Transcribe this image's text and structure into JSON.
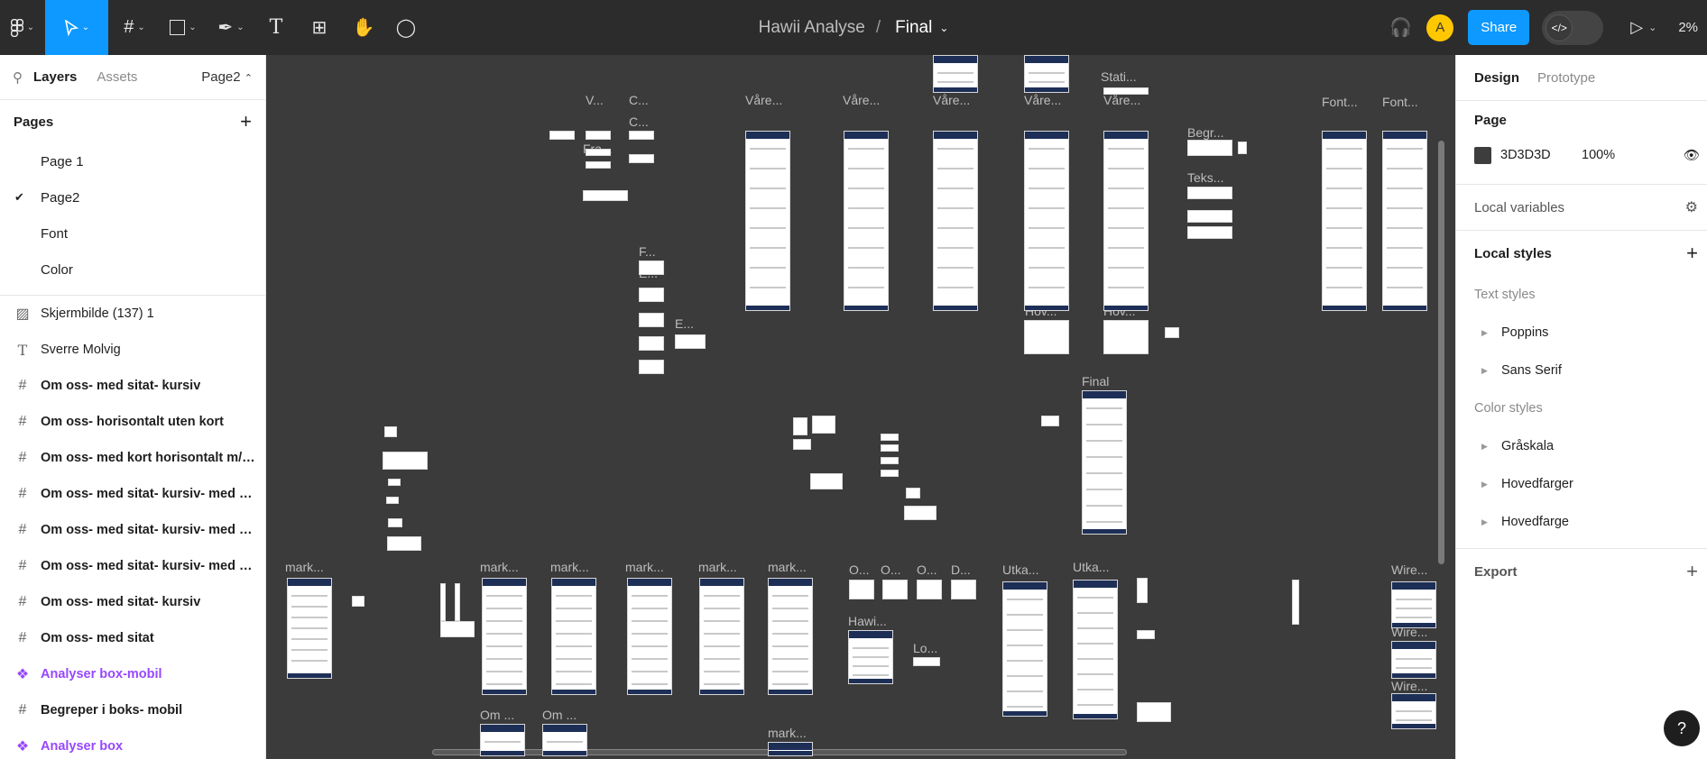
{
  "toolbar": {
    "tools": [
      {
        "name": "main-menu-tool",
        "icon": "figma-logo-icon"
      },
      {
        "name": "move-tool",
        "icon": "cursor-icon",
        "active": true
      },
      {
        "name": "frame-tool",
        "icon": "frame-icon"
      },
      {
        "name": "shape-tool",
        "icon": "rectangle-icon"
      },
      {
        "name": "pen-tool",
        "icon": "pen-icon"
      },
      {
        "name": "text-tool",
        "icon": "text-icon"
      },
      {
        "name": "resources-tool",
        "icon": "components-icon"
      },
      {
        "name": "hand-tool",
        "icon": "hand-icon"
      },
      {
        "name": "comment-tool",
        "icon": "comment-icon"
      }
    ],
    "project": "Hawii Analyse",
    "separator": "/",
    "file": "Final",
    "avatar_initial": "A",
    "share_label": "Share",
    "zoom": "2%"
  },
  "left_panel": {
    "tabs": [
      "Layers",
      "Assets"
    ],
    "active_tab": "Layers",
    "current_page": "Page2",
    "pages_title": "Pages",
    "pages": [
      "Page 1",
      "Page2",
      "Font",
      "Color"
    ],
    "selected_page": "Page2",
    "layers": [
      {
        "type": "image",
        "label": "Skjermbilde (137) 1"
      },
      {
        "type": "text",
        "label": "Sverre Molvig"
      },
      {
        "type": "frame",
        "label": "Om oss- med sitat- kursiv"
      },
      {
        "type": "frame",
        "label": "Om oss- horisontalt uten kort"
      },
      {
        "type": "frame",
        "label": "Om oss- med kort horisontalt m/k..."
      },
      {
        "type": "frame",
        "label": "Om oss- med sitat- kursiv- med bi..."
      },
      {
        "type": "frame",
        "label": "Om oss- med sitat- kursiv- med bi..."
      },
      {
        "type": "frame",
        "label": "Om oss- med sitat- kursiv- med bi..."
      },
      {
        "type": "frame",
        "label": "Om oss- med sitat- kursiv"
      },
      {
        "type": "frame",
        "label": "Om oss- med sitat"
      },
      {
        "type": "component",
        "label": "Analyser box-mobil"
      },
      {
        "type": "frame",
        "label": "Begreper i boks- mobil"
      },
      {
        "type": "component",
        "label": "Analyser box"
      }
    ]
  },
  "right_panel": {
    "tabs": [
      "Design",
      "Prototype"
    ],
    "active_tab": "Design",
    "page_title": "Page",
    "bg_color_hex": "3D3D3D",
    "bg_color": "#3d3d3d",
    "opacity": "100%",
    "local_variables": "Local variables",
    "local_styles": "Local styles",
    "text_styles_title": "Text styles",
    "text_styles": [
      "Poppins",
      "Sans Serif"
    ],
    "color_styles_title": "Color styles",
    "color_styles": [
      "Gråskala",
      "Hovedfarger",
      "Hovedfarge"
    ],
    "export": "Export",
    "help": "?"
  },
  "canvas": {
    "labels": [
      "Stati...",
      "V...",
      "C...",
      "C...",
      "Fra...",
      "Våre...",
      "Våre...",
      "Våre...",
      "Våre...",
      "Våre...",
      "Begr...",
      "Teks...",
      "Font...",
      "Font...",
      "F...",
      "E...",
      "E...",
      "Hov...",
      "Hov...",
      "Final",
      "mark...",
      "mark...",
      "mark...",
      "mark...",
      "mark...",
      "mark...",
      "O...",
      "O...",
      "O...",
      "D...",
      "Utka...",
      "Utka...",
      "Wire...",
      "Wire...",
      "Wire...",
      "Hawi...",
      "Lo...",
      "Om ...",
      "Om ...",
      "mark..."
    ]
  }
}
